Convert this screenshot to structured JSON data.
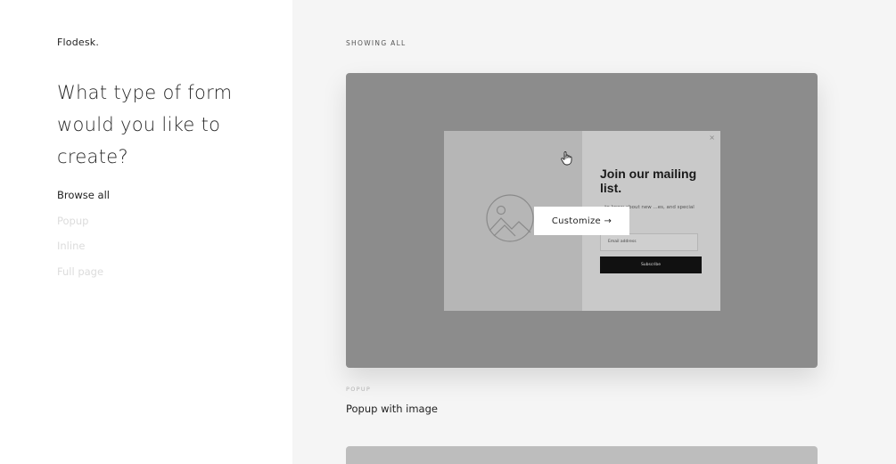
{
  "brand": {
    "logo": "Flodesk."
  },
  "sidebar": {
    "headline": "What type of form would you like to create?",
    "filters": [
      {
        "label": "Browse all",
        "active": true
      },
      {
        "label": "Popup",
        "active": false
      },
      {
        "label": "Inline",
        "active": false
      },
      {
        "label": "Full page",
        "active": false
      }
    ]
  },
  "gallery": {
    "showing_label": "SHOWING ALL",
    "cards": [
      {
        "category": "POPUP",
        "name": "Popup with image",
        "customize_label": "Customize →",
        "preview": {
          "title": "Join our mailing list.",
          "description": "...to know about new ...es, and special events.",
          "email_placeholder": "Email address",
          "subscribe_label": "Subscribe",
          "close_icon": "×",
          "image_icon": "image-placeholder-icon"
        }
      }
    ]
  },
  "colors": {
    "sidebar_bg": "#ffffff",
    "main_bg": "#f5f5f5",
    "card_overlay": "#8c8c8c",
    "inactive_text": "#dcdcdc"
  }
}
